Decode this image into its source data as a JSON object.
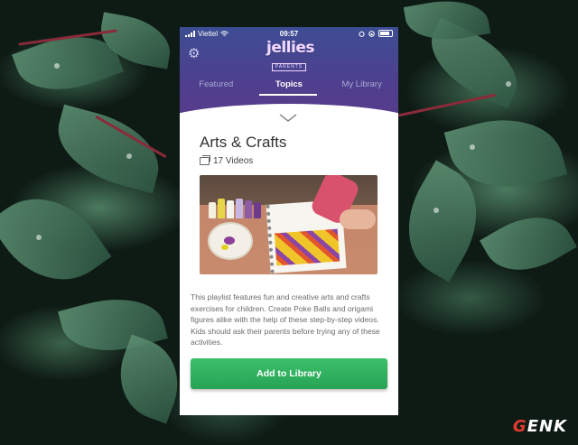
{
  "status_bar": {
    "carrier": "Viettel",
    "time": "09:57"
  },
  "logo": {
    "main": "jellies",
    "sub": "PARENTS"
  },
  "tabs": [
    {
      "label": "Featured",
      "active": false
    },
    {
      "label": "Topics",
      "active": true
    },
    {
      "label": "My Library",
      "active": false
    }
  ],
  "playlist": {
    "title": "Arts & Crafts",
    "video_count": "17 Videos",
    "description": "This playlist features fun and creative arts and crafts exercises for children. Create Poke Balls and origami figures alike with the help of these step-by-step videos. Kids should ask their parents before trying any of these activities."
  },
  "action_button": {
    "label": "Add to Library"
  },
  "watermark": {
    "text": "GENK"
  },
  "colors": {
    "header_top": "#3d4d93",
    "header_bottom": "#5c3a89",
    "button": "#2fae5e"
  },
  "icons": [
    "gear-icon",
    "chevron-down-icon",
    "video-stack-icon",
    "wifi-icon",
    "battery-icon"
  ]
}
